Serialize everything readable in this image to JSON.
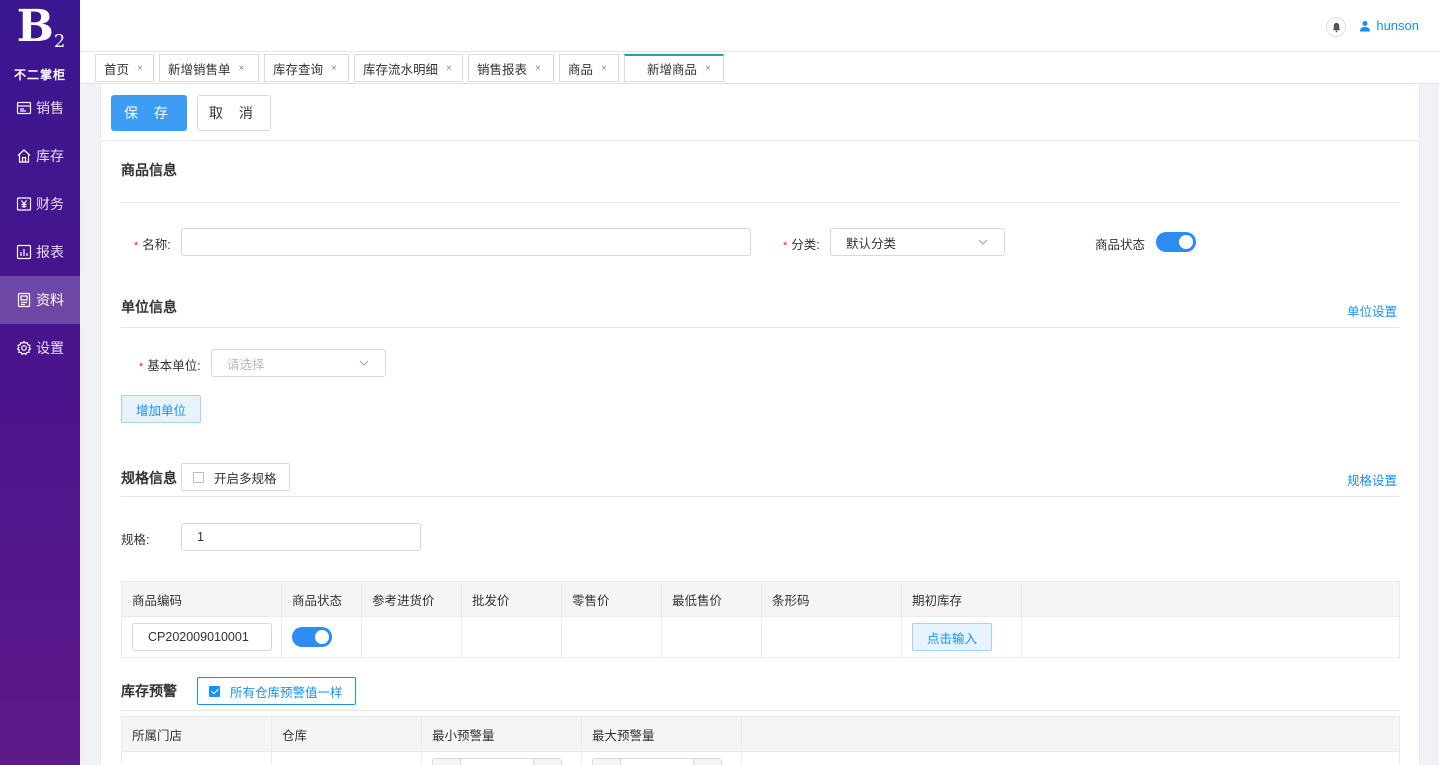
{
  "brand": {
    "mark": "B",
    "sub": "2",
    "name": "不二掌柜"
  },
  "nav": [
    {
      "label": "销售",
      "icon": "sales-icon"
    },
    {
      "label": "库存",
      "icon": "home-icon"
    },
    {
      "label": "财务",
      "icon": "yen-icon"
    },
    {
      "label": "报表",
      "icon": "report-icon"
    },
    {
      "label": "资料",
      "icon": "document-icon",
      "active": true
    },
    {
      "label": "设置",
      "icon": "gear-icon"
    }
  ],
  "header": {
    "username": "hunson"
  },
  "tabs": [
    {
      "label": "首页"
    },
    {
      "label": "新增销售单"
    },
    {
      "label": "库存查询"
    },
    {
      "label": "库存流水明细"
    },
    {
      "label": "销售报表"
    },
    {
      "label": "商品"
    },
    {
      "label": "新增商品",
      "active": true
    }
  ],
  "tab_close": "×",
  "toolbar": {
    "save": "保 存",
    "cancel": "取 消"
  },
  "product_info": {
    "title": "商品信息",
    "name_label": "名称:",
    "name_value": "",
    "category_label": "分类:",
    "category_value": "默认分类",
    "status_label": "商品状态",
    "status_on": true
  },
  "unit_info": {
    "title": "单位信息",
    "settings_link": "单位设置",
    "base_unit_label": "基本单位:",
    "base_unit_placeholder": "请选择",
    "add_unit": "增加单位"
  },
  "spec_info": {
    "title": "规格信息",
    "multi_spec_label": "开启多规格",
    "multi_spec_checked": false,
    "settings_link": "规格设置",
    "spec_label": "规格:",
    "spec_value": "1"
  },
  "sku_table": {
    "columns": [
      "商品编码",
      "商品状态",
      "参考进货价",
      "批发价",
      "零售价",
      "最低售价",
      "条形码",
      "期初库存",
      ""
    ],
    "row": {
      "code": "CP202009010001",
      "status_on": true,
      "purchase_price": "",
      "wholesale_price": "",
      "retail_price": "",
      "min_price": "",
      "barcode": "",
      "opening_stock_button": "点击输入"
    }
  },
  "stock_alert": {
    "title": "库存预警",
    "same_for_all_label": "所有仓库预警值一样",
    "same_for_all_checked": true,
    "columns": [
      "所属门店",
      "仓库",
      "最小预警量",
      "最大预警量",
      ""
    ]
  },
  "colors": {
    "primary": "#3d9df4",
    "sidebar_top": "#3a1790",
    "sidebar_bottom": "#5e1a8a",
    "required": "#f5222d",
    "tab_active_accent": "#26a69a"
  }
}
